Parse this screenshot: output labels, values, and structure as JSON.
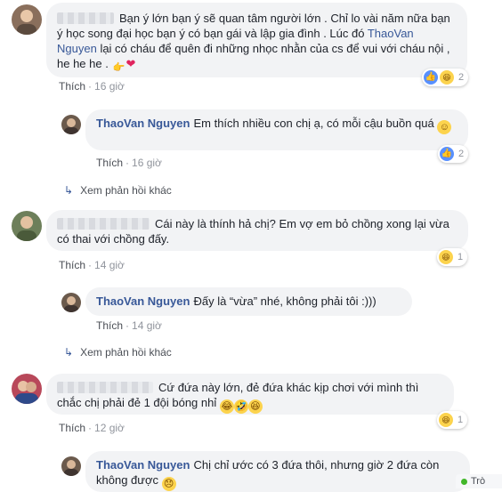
{
  "actions": {
    "like": "Thích",
    "more_replies": "Xem phản hồi khác"
  },
  "colors": {
    "link": "#385898",
    "bubble": "#f2f3f5",
    "meta": "#90949c"
  },
  "comments": [
    {
      "text": "Bạn ý lớn bạn ý sẽ quan tâm người lớn . Chỉ lo vài năm nữa bạn ý học song đại học bạn ý có bạn gái và lập gia đình . Lúc đó",
      "mention": "ThaoVan Nguyen",
      "text2": "lại có cháu để quên đi những nhọc nhằn của cs để vui với cháu nội , he he he .",
      "time": "16 giờ",
      "reaction_count": "2",
      "reply": {
        "name": "ThaoVan Nguyen",
        "text": "Em thích nhiều con chị ạ, có mỗi cậu buồn quá",
        "time": "16 giờ",
        "reaction_count": "2"
      }
    },
    {
      "text": "Cái này là thính hả chị? Em vợ em bỏ chồng xong lại vừa có thai với chồng đấy.",
      "time": "14 giờ",
      "reaction_count": "1",
      "reply": {
        "name": "ThaoVan Nguyen",
        "text": "Đấy là “vừa” nhé, không phải tôi :)))",
        "time": "14 giờ"
      }
    },
    {
      "text": "Cứ đứa này lớn, đẻ đứa khác kịp chơi với mình thì chắc chị phải đẻ 1 đội bóng nhỉ",
      "time": "12 giờ",
      "reaction_count": "1",
      "reply": {
        "name": "ThaoVan Nguyen",
        "text": "Chị chỉ ước có 3 đứa thôi, nhưng giờ 2 đứa còn không được"
      }
    }
  ],
  "chat_corner": "Trò"
}
